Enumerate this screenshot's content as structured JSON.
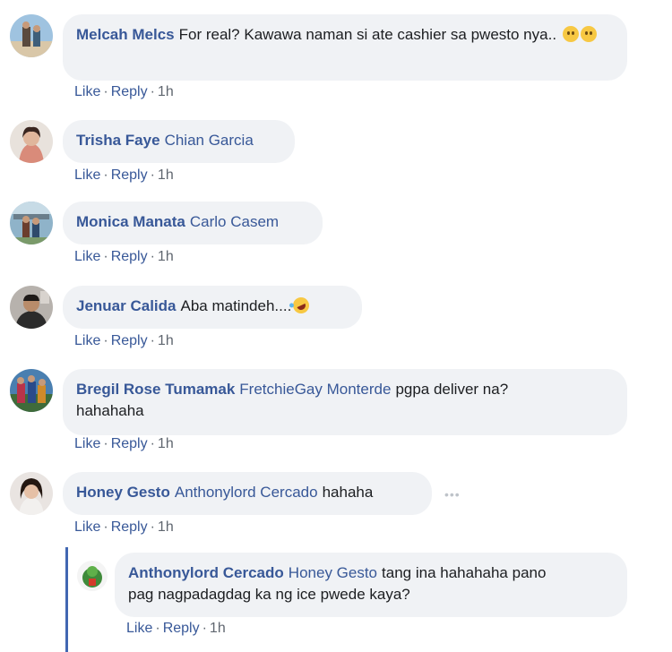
{
  "comments": [
    {
      "author": "Melcah Melcs",
      "text": "For real? Kawawa naman si ate cashier sa pwesto nya..",
      "emoji": "pleading-face",
      "like": "Like",
      "reply": "Reply",
      "time": "1h"
    },
    {
      "author": "Trisha Faye",
      "tag": "Chian Garcia",
      "like": "Like",
      "reply": "Reply",
      "time": "1h"
    },
    {
      "author": "Monica Manata",
      "tag": "Carlo Casem",
      "like": "Like",
      "reply": "Reply",
      "time": "1h"
    },
    {
      "author": "Jenuar Calida",
      "text": "Aba matindeh....",
      "emoji": "rolling-on-floor-laughing",
      "like": "Like",
      "reply": "Reply",
      "time": "1h"
    },
    {
      "author": "Bregil Rose Tumamak",
      "tag": "FretchieGay Monterde",
      "text_line1": "pgpa deliver na?",
      "text_line2": "hahahaha",
      "like": "Like",
      "reply": "Reply",
      "time": "1h"
    },
    {
      "author": "Honey Gesto",
      "tag": "Anthonylord Cercado",
      "text": "hahaha",
      "like": "Like",
      "reply": "Reply",
      "time": "1h"
    }
  ],
  "reply": {
    "author": "Anthonylord Cercado",
    "tag": "Honey Gesto",
    "text_line1": "tang ina hahahaha pano",
    "text_line2": "pag nagpadagdag ka ng ice pwede kaya?",
    "like": "Like",
    "reply": "Reply",
    "time": "1h"
  },
  "separator": "·",
  "more_options": "•••",
  "colors": {
    "name_link": "#385898",
    "bubble_bg": "#f0f2f5",
    "meta_gray": "#606770",
    "reply_line": "#4267b2"
  }
}
